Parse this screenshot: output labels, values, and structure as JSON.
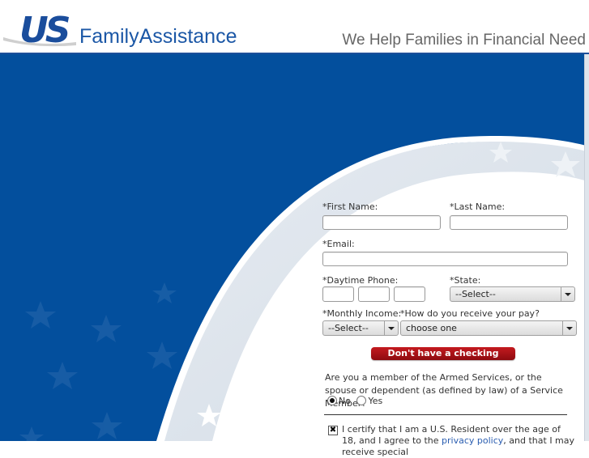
{
  "header": {
    "logo_us": "US",
    "logo_text": "FamilyAssistance",
    "tagline": "We Help Families in Financial Need"
  },
  "colors": {
    "brand_blue": "#034f9d",
    "logo_blue": "#1a4d9c",
    "logo_red": "#b3141b",
    "cta_red": "#a5131a"
  },
  "form": {
    "first_name_label": "*First Name:",
    "first_name_value": "",
    "last_name_label": "*Last Name:",
    "last_name_value": "",
    "email_label": "*Email:",
    "email_value": "",
    "phone_label": "*Daytime Phone:",
    "phone_area_value": "",
    "phone_prefix_value": "",
    "phone_line_value": "",
    "state_label": "*State:",
    "state_selected": "--Select--",
    "income_label": "*Monthly Income:",
    "income_selected": "--Select--",
    "pay_label": "*How do you receive your pay?",
    "pay_selected": "choose one",
    "no_checking_button": "Don't have a checking account?",
    "military_question": "Are you a member of the Armed Services, or the spouse or dependent (as defined by law) of a Service Member?",
    "military_options": [
      {
        "label": "No",
        "selected": true
      },
      {
        "label": "Yes",
        "selected": false
      }
    ],
    "certify_checked": true,
    "certify_text_1": "I certify that I am a U.S. Resident over the age of 18, and I agree to the ",
    "certify_link": "privacy policy",
    "certify_text_2": ", and that I may receive special"
  }
}
